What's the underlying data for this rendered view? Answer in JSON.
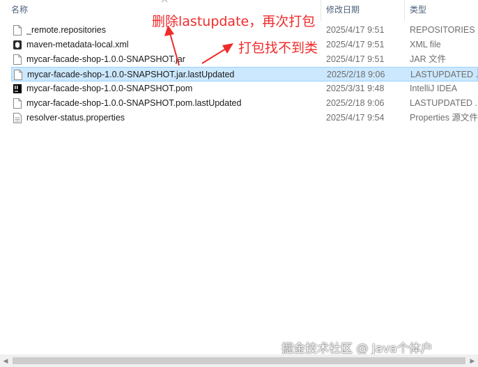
{
  "header": {
    "name_label": "名称",
    "date_label": "修改日期",
    "type_label": "类型"
  },
  "files": [
    {
      "name": "_remote.repositories",
      "date": "2025/4/17 9:51",
      "type": "REPOSITORIES ...",
      "icon": "file-icon"
    },
    {
      "name": "maven-metadata-local.xml",
      "date": "2025/4/17 9:51",
      "type": "XML file",
      "icon": "xml-file-icon"
    },
    {
      "name": "mycar-facade-shop-1.0.0-SNAPSHOT.jar",
      "date": "2025/4/17 9:51",
      "type": "JAR 文件",
      "icon": "file-icon"
    },
    {
      "name": "mycar-facade-shop-1.0.0-SNAPSHOT.jar.lastUpdated",
      "date": "2025/2/18 9:06",
      "type": "LASTUPDATED ...",
      "icon": "file-icon"
    },
    {
      "name": "mycar-facade-shop-1.0.0-SNAPSHOT.pom",
      "date": "2025/3/31 9:48",
      "type": "IntelliJ IDEA",
      "icon": "intellij-icon"
    },
    {
      "name": "mycar-facade-shop-1.0.0-SNAPSHOT.pom.lastUpdated",
      "date": "2025/2/18 9:06",
      "type": "LASTUPDATED ...",
      "icon": "file-icon"
    },
    {
      "name": "resolver-status.properties",
      "date": "2025/4/17 9:54",
      "type": "Properties 源文件",
      "icon": "properties-file-icon"
    }
  ],
  "annotations": {
    "delete_note": "删除lastupdate，再次打包",
    "error_note": "打包找不到类"
  },
  "watermark": "掘金技术社区 @ Java个体户",
  "colors": {
    "annotation": "#ef2b2b",
    "selection_bg": "#cce8ff",
    "selection_border": "#99d1ff"
  }
}
